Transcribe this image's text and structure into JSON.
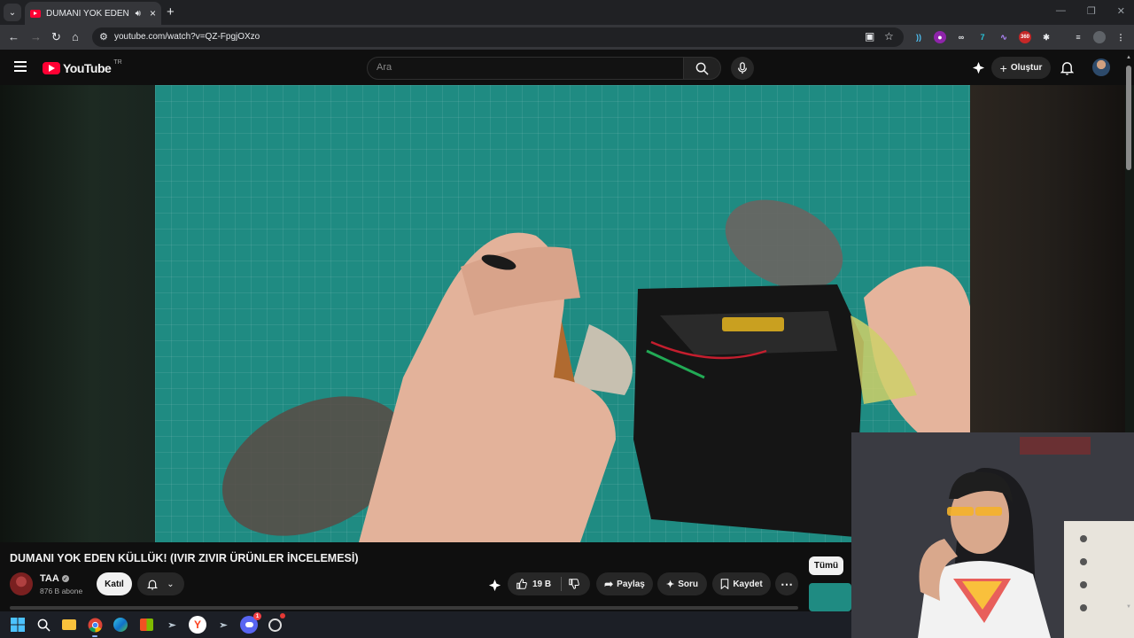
{
  "browser": {
    "tab": {
      "title": "DUMANI YOK EDEN KÜLLÜK! (IVIR ZIVIR ÜRÜNLER İNCELEMESİ) - YouTube",
      "favicon": "youtube-icon",
      "audio_icon": "speaker-icon"
    },
    "address": "youtube.com/watch?v=QZ-FpgjOXzo",
    "nav_icons": [
      "back-icon",
      "forward-icon",
      "reload-icon",
      "home-icon"
    ],
    "extension_badge": "360"
  },
  "youtube": {
    "logo_text": "YouTube",
    "country_code": "TR",
    "search_placeholder": "Ara",
    "create_label": "Oluştur"
  },
  "video": {
    "title": "DUMANI YOK EDEN KÜLLÜK! (IVIR ZIVIR ÜRÜNLER İNCELEMESİ)",
    "channel": "TAA",
    "subscribers": "876 B abone",
    "join_label": "Katıl",
    "likes": "19 B",
    "share_label": "Paylaş",
    "ask_label": "Soru",
    "save_label": "Kaydet"
  },
  "recommendations": {
    "filter_chip": "Tümü"
  },
  "taskbar": {
    "items": [
      "windows-start-icon",
      "search-icon",
      "file-explorer-icon",
      "chrome-icon",
      "edge-icon",
      "store-icon",
      "steam-icon",
      "yandex-icon",
      "steam-alt-icon",
      "discord-icon",
      "obs-icon"
    ],
    "discord_badge": "1"
  },
  "colors": {
    "youtube_red": "#ff0033",
    "background": "#0f0f0f",
    "pill_bg": "#272727",
    "video_mat": "#1f8b82"
  }
}
